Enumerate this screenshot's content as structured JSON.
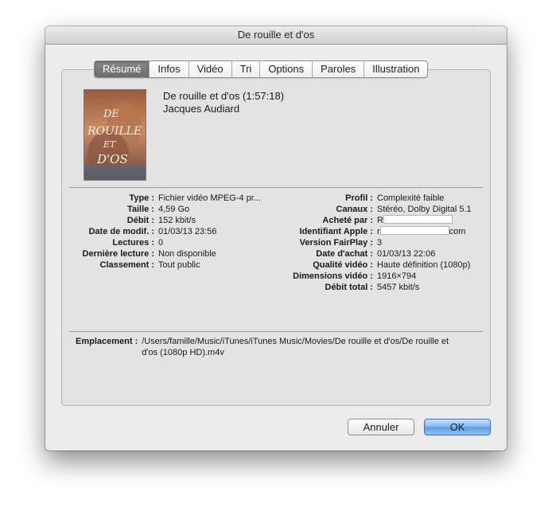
{
  "window": {
    "title": "De rouille et d'os"
  },
  "tabs": [
    {
      "label": "Résumé",
      "active": true
    },
    {
      "label": "Infos"
    },
    {
      "label": "Vidéo"
    },
    {
      "label": "Tri"
    },
    {
      "label": "Options"
    },
    {
      "label": "Paroles"
    },
    {
      "label": "Illustration"
    }
  ],
  "summary": {
    "title": "De rouille et d'os (1:57:18)",
    "director": "Jacques Audiard",
    "poster_text": [
      "DE",
      "ROUILLE",
      "ET",
      "D'OS"
    ]
  },
  "left_info": [
    {
      "label": "Type :",
      "value": "Fichier vidéo MPEG-4 pr..."
    },
    {
      "label": "Taille :",
      "value": "4,59 Go"
    },
    {
      "label": "Débit :",
      "value": "152 kbit/s"
    },
    {
      "label": "Date de modif. :",
      "value": "01/03/13 23:56"
    },
    {
      "label": "Lectures :",
      "value": "0"
    },
    {
      "label": "Dernière lecture :",
      "value": "Non disponible"
    },
    {
      "label": "Classement :",
      "value": "Tout public"
    }
  ],
  "right_info": [
    {
      "label": "Profil :",
      "value": "Complexité faible"
    },
    {
      "label": "Canaux :",
      "value": "Stéréo, Dolby Digital 5.1"
    },
    {
      "label": "Acheté par :",
      "value": "R",
      "redacted_after": true
    },
    {
      "label": "Identifiant Apple :",
      "value": "r",
      "redacted_after": true,
      "suffix": "com"
    },
    {
      "label": "Version FairPlay :",
      "value": "3"
    },
    {
      "label": "Date d'achat :",
      "value": "01/03/13 22:06"
    },
    {
      "label": "Qualité vidéo :",
      "value": "Haute définition (1080p)"
    },
    {
      "label": "Dimensions vidéo :",
      "value": "1916×794"
    },
    {
      "label": "Débit total :",
      "value": "5457 kbit/s"
    }
  ],
  "location": {
    "label": "Emplacement :",
    "value": "/Users/famille/Music/iTunes/iTunes Music/Movies/De rouille et d'os/De rouille et d'os (1080p HD).m4v"
  },
  "buttons": {
    "cancel": "Annuler",
    "ok": "OK"
  },
  "colors": {
    "ok_accent": "#5d9ce7",
    "active_tab": "#6c6c6c"
  }
}
